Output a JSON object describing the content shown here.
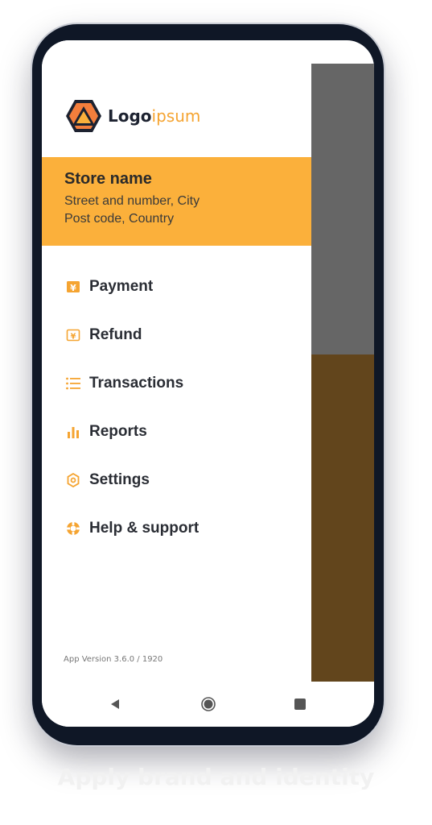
{
  "brand": {
    "name_main": "Logo",
    "name_accent": "ipsum",
    "accent_color": "#fbb03b"
  },
  "store": {
    "name": "Store name",
    "address_line1": "Street and number, City",
    "address_line2": "Post code, Country"
  },
  "menu": {
    "items": [
      {
        "label": "Payment",
        "icon": "payment-icon"
      },
      {
        "label": "Refund",
        "icon": "refund-icon"
      },
      {
        "label": "Transactions",
        "icon": "list-icon"
      },
      {
        "label": "Reports",
        "icon": "bar-chart-icon"
      },
      {
        "label": "Settings",
        "icon": "gear-icon"
      },
      {
        "label": "Help & support",
        "icon": "lifebuoy-icon"
      }
    ]
  },
  "app_version": "App Version 3.6.0 / 1920",
  "navigation_bar": {
    "back": "back-icon",
    "home": "home-icon",
    "recents": "recents-icon"
  },
  "caption": "Apply brand and identity"
}
